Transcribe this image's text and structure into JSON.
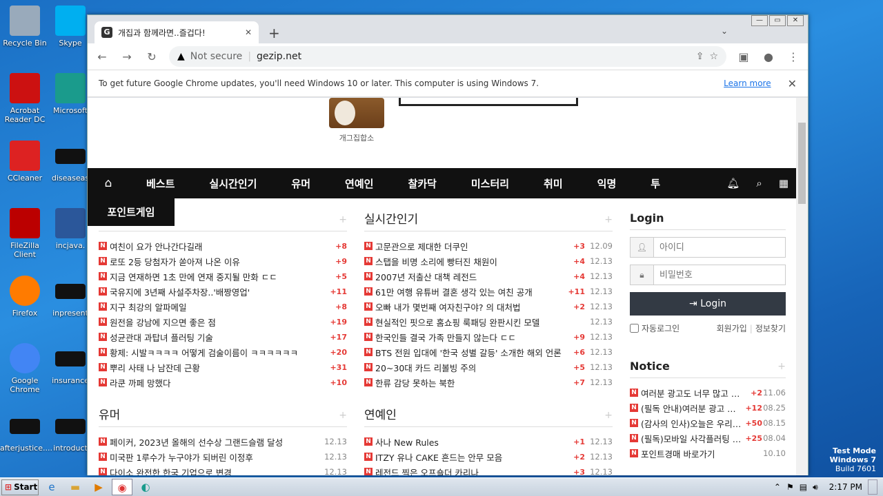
{
  "desktop": {
    "icons": [
      {
        "label": "Recycle Bin",
        "icon": "recycle-bin-icon"
      },
      {
        "label": "Skype",
        "icon": "skype-icon"
      },
      {
        "label": "Acrobat Reader DC",
        "icon": "acrobat-icon"
      },
      {
        "label": "Microsoft",
        "icon": "edge-icon"
      },
      {
        "label": "CCleaner",
        "icon": "ccleaner-icon"
      },
      {
        "label": "diseaseas",
        "icon": "file-icon"
      },
      {
        "label": "FileZilla Client",
        "icon": "filezilla-icon"
      },
      {
        "label": "incjava.",
        "icon": "word-icon"
      },
      {
        "label": "Firefox",
        "icon": "firefox-icon"
      },
      {
        "label": "inpresent",
        "icon": "file-icon"
      },
      {
        "label": "Google Chrome",
        "icon": "chrome-icon"
      },
      {
        "label": "insurance",
        "icon": "file-icon"
      },
      {
        "label": "afterjustice....",
        "icon": "file-icon"
      },
      {
        "label": "introduct",
        "icon": "file-icon"
      }
    ]
  },
  "browser": {
    "tab_title": "개집과 함께라면..즐겁다!",
    "not_secure": "Not secure",
    "url": "gezip.net",
    "infobar": {
      "message": "To get future Google Chrome updates, you'll need Windows 10 or later. This computer is using Windows 7.",
      "link": "Learn more"
    }
  },
  "site": {
    "logo_caption": "개그집합소",
    "nav": [
      "베스트",
      "실시간인기",
      "유머",
      "연예인",
      "찰카닥",
      "미스터리",
      "취미",
      "익명",
      "투"
    ],
    "point_game": "포인트게임",
    "left_list": [
      {
        "t": "여친이 요가 안나간다길래",
        "c": "+8"
      },
      {
        "t": "로또 2등 당첨자가 쏟아져 나온 이유",
        "c": "+9"
      },
      {
        "t": "지금 연재하면 1초 만에 연재 중지될 만화 ㄷㄷ",
        "c": "+5"
      },
      {
        "t": "국유지에 3년째 사설주차장..'배짱영업'",
        "c": "+11"
      },
      {
        "t": "지구 최강의 알파메일",
        "c": "+8"
      },
      {
        "t": "원전을 강남에 지으면 좋은 점",
        "c": "+19"
      },
      {
        "t": "성균관대 과탑녀 플러팅 기술",
        "c": "+17"
      },
      {
        "t": "황제: 시발ㅋㅋㅋㅋ 어떻게 검술이름이 ㅋㅋㅋㅋㅋㅋ",
        "c": "+20"
      },
      {
        "t": "뿌리 사태 나 남잔데 근황",
        "c": "+31"
      },
      {
        "t": "라쿤 까페 망했다",
        "c": "+10"
      }
    ],
    "realtime": {
      "title": "실시간인기",
      "items": [
        {
          "t": "고문관으로 제대한 더쿠인",
          "c": "+3",
          "d": "12.09"
        },
        {
          "t": "스탭을 비명 소리에 빵터진 채원이",
          "c": "+4",
          "d": "12.13"
        },
        {
          "t": "2007년 저출산 대책 레전드",
          "c": "+4",
          "d": "12.13"
        },
        {
          "t": "61만 여행 유튜버 결혼 생각 있는 여친 공개",
          "c": "+11",
          "d": "12.13"
        },
        {
          "t": "오빠 내가 몇번째 여자친구야? 의 대처법",
          "c": "+2",
          "d": "12.13"
        },
        {
          "t": "현실적인 핏으로 홈쇼핑 룩패딩 완판시킨 모델",
          "c": "",
          "d": "12.13"
        },
        {
          "t": "한국인들 결국 가족 만들지 않는다 ㄷㄷ",
          "c": "+9",
          "d": "12.13"
        },
        {
          "t": "BTS 전원 입대에 '한국 성별 갈등' 소개한 해외 언론",
          "c": "+6",
          "d": "12.13"
        },
        {
          "t": "20~30대 카드 리볼빙 주의",
          "c": "+5",
          "d": "12.13"
        },
        {
          "t": "한류 감당 못하는 북한",
          "c": "+7",
          "d": "12.13"
        }
      ]
    },
    "humor": {
      "title": "유머",
      "items": [
        {
          "t": "페이커, 2023년 올해의 선수상 그랜드슬램 달성",
          "c": "",
          "d": "12.13"
        },
        {
          "t": "미국판 1루수가 누구야가 되버린 이정후",
          "c": "",
          "d": "12.13"
        },
        {
          "t": "다이소 완전한 한국 기업으로 변경",
          "c": "",
          "d": "12.13"
        }
      ]
    },
    "celeb": {
      "title": "연예인",
      "items": [
        {
          "t": "사나 New Rules",
          "c": "+1",
          "d": "12.13"
        },
        {
          "t": "ITZY 유나 CAKE 흔드는 안무 모음",
          "c": "+2",
          "d": "12.13"
        },
        {
          "t": "레전드 찍은 오프숄더 카리나",
          "c": "+3",
          "d": "12.13"
        }
      ]
    },
    "login": {
      "title": "Login",
      "id_placeholder": "아이디",
      "pw_placeholder": "비밀번호",
      "button": "Login",
      "auto": "자동로그인",
      "join": "회원가입",
      "find": "정보찾기"
    },
    "notice": {
      "title": "Notice",
      "items": [
        {
          "t": "여러분 광고도 너무 많고 …",
          "c": "+2",
          "d": "11.06"
        },
        {
          "t": "(필독 안내)여러분 광고 …",
          "c": "+12",
          "d": "08.25"
        },
        {
          "t": "(감사의 인사)오늘은 우리…",
          "c": "+50",
          "d": "08.15"
        },
        {
          "t": "(필독)모바일 사각플러팅 …",
          "c": "+25",
          "d": "08.04"
        },
        {
          "t": "포인트경매 바로가기",
          "c": "",
          "d": "10.10"
        }
      ]
    }
  },
  "taskbar": {
    "start": "Start",
    "time": "2:17 PM"
  },
  "watermark": {
    "line1": "Test Mode",
    "line2": "Windows 7",
    "line3": "Build 7601"
  }
}
